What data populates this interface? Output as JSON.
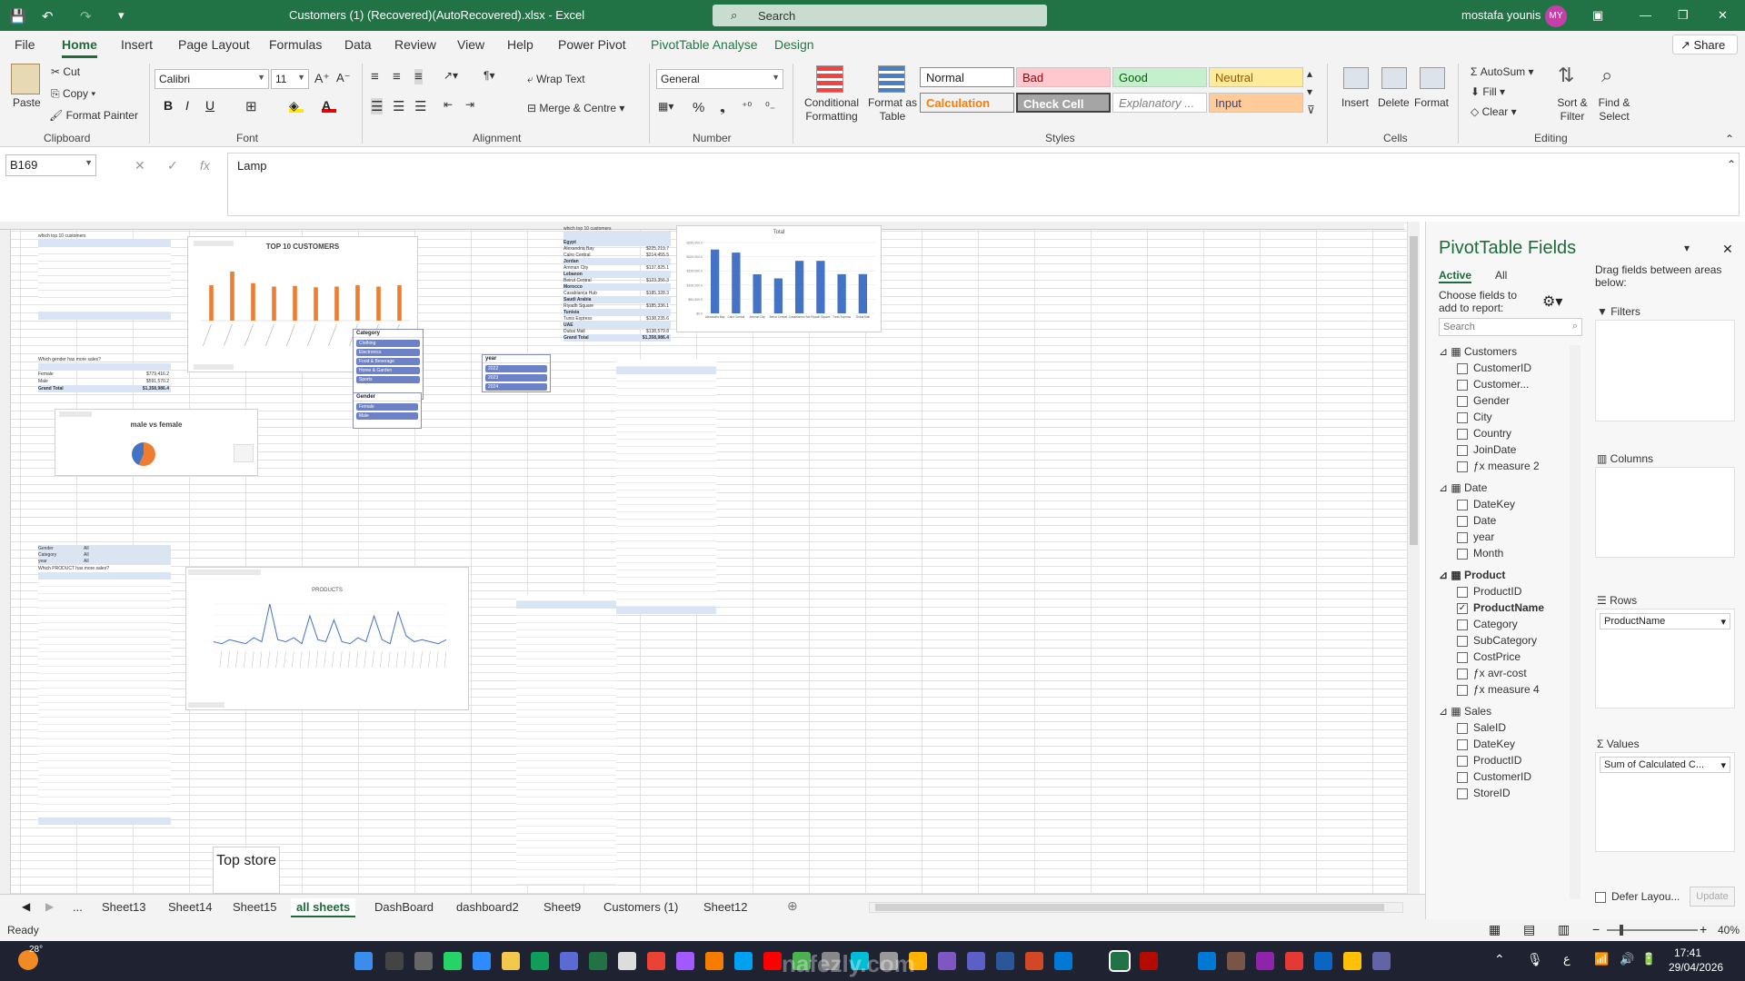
{
  "window": {
    "title": "Customers (1) (Recovered)(AutoRecovered).xlsx - Excel",
    "search": "Search",
    "user": "mostafa younis",
    "initials": "MY"
  },
  "ribbon_tabs": [
    "File",
    "Home",
    "Insert",
    "Page Layout",
    "Formulas",
    "Data",
    "Review",
    "View",
    "Help",
    "Power Pivot",
    "PivotTable Analyse",
    "Design"
  ],
  "share": "Share",
  "clipboard": {
    "paste": "Paste",
    "cut": "Cut",
    "copy": "Copy",
    "format_painter": "Format Painter",
    "label": "Clipboard"
  },
  "font": {
    "name": "Calibri",
    "size": "11",
    "label": "Font",
    "bold": "B",
    "italic": "I",
    "underline": "U"
  },
  "alignment": {
    "wrap": "Wrap Text",
    "merge": "Merge & Centre",
    "label": "Alignment"
  },
  "number": {
    "format": "General",
    "label": "Number"
  },
  "styles": {
    "cond": "Conditional Formatting",
    "fmt_table": "Format as Table",
    "label": "Styles",
    "normal": "Normal",
    "bad": "Bad",
    "good": "Good",
    "neutral": "Neutral",
    "calculation": "Calculation",
    "check": "Check Cell",
    "explanatory": "Explanatory ...",
    "input": "Input"
  },
  "cells": {
    "insert": "Insert",
    "delete": "Delete",
    "format": "Format",
    "label": "Cells"
  },
  "editing": {
    "autosum": "AutoSum",
    "fill": "Fill",
    "clear": "Clear",
    "sort": "Sort & Filter",
    "find": "Find & Select",
    "label": "Editing"
  },
  "formula_bar": {
    "namebox": "B169",
    "fx": "fx",
    "value": "Lamp"
  },
  "sheet": {
    "top10_table_title": "which top 10 customers",
    "top10_chart_title": "TOP 10 CUSTOMERS",
    "gender_q": "Which gender has more sales?",
    "gender_rows": [
      [
        "Female",
        "$779,416.2"
      ],
      [
        "Male",
        "$591,570.2"
      ],
      [
        "Grand Total",
        "$1,358,986.4"
      ]
    ],
    "male_female_title": "male vs female",
    "country_q": "which top 10 customers",
    "country_rows": [
      [
        "Egypt",
        ""
      ],
      [
        "Alexandria Bay",
        "$225,219.7"
      ],
      [
        "Cairo Central",
        "$214,455.5"
      ],
      [
        "Jordan",
        ""
      ],
      [
        "Amman City",
        "$137,825.1"
      ],
      [
        "Lebanon",
        ""
      ],
      [
        "Beirut Central",
        "$123,356.3"
      ],
      [
        "Morocco",
        ""
      ],
      [
        "Casablanca Hub",
        "$185,328.3"
      ],
      [
        "Saudi Arabia",
        ""
      ],
      [
        "Riyadh Square",
        "$185,336.1"
      ],
      [
        "Tunisia",
        ""
      ],
      [
        "Tunis Express",
        "$138,235.6"
      ],
      [
        "UAE",
        ""
      ],
      [
        "Dubai Mall",
        "$138,579.8"
      ],
      [
        "Grand Total",
        "$1,358,986.4"
      ]
    ],
    "total_chart_title": "Total",
    "products_chart_title": "PRODUCTS",
    "product_q": "Which PRODUCT has more sales?",
    "slicer_category": {
      "title": "Category",
      "items": [
        "Clothing",
        "Electronics",
        "Food & Beverage",
        "Home & Garden",
        "Sports"
      ]
    },
    "slicer_year": {
      "title": "year",
      "items": [
        "2022",
        "2023",
        "2024"
      ]
    },
    "slicer_gender": {
      "title": "Gender",
      "items": [
        "Female",
        "Male"
      ]
    },
    "filters": [
      [
        "Gender",
        "All"
      ],
      [
        "Category",
        "All"
      ],
      [
        "year",
        "All"
      ]
    ],
    "top_store": "Top store"
  },
  "sheet_tabs": [
    "...",
    "Sheet13",
    "Sheet14",
    "Sheet15",
    "all sheets",
    "DashBoard",
    "dashboard2",
    "Sheet9",
    "Customers (1)",
    "Sheet12"
  ],
  "active_sheet": "all sheets",
  "status": {
    "ready": "Ready",
    "zoom": "40%"
  },
  "pivot": {
    "title": "PivotTable Fields",
    "tab_active": "Active",
    "tab_all": "All",
    "choose": "Choose fields to add to report:",
    "search": "Search",
    "drag": "Drag fields between areas below:",
    "tables": [
      {
        "name": "Customers",
        "fields": [
          "CustomerID",
          "Customer...",
          "Gender",
          "City",
          "Country",
          "JoinDate",
          "measure 2"
        ]
      },
      {
        "name": "Date",
        "fields": [
          "DateKey",
          "Date",
          "year",
          "Month"
        ]
      },
      {
        "name": "Product",
        "fields": [
          "ProductID",
          "ProductName",
          "Category",
          "SubCategory",
          "CostPrice",
          "avr-cost",
          "measure 4"
        ]
      },
      {
        "name": "Sales",
        "fields": [
          "SaleID",
          "DateKey",
          "ProductID",
          "CustomerID",
          "StoreID"
        ]
      }
    ],
    "filters": "Filters",
    "columns": "Columns",
    "rows": "Rows",
    "rows_value": "ProductName",
    "values": "Values",
    "values_value": "Sum of Calculated C...",
    "defer": "Defer Layou...",
    "update": "Update"
  },
  "taskbar": {
    "temp": "28°",
    "time": "17:41",
    "date": "29/04/2026"
  },
  "watermark": "nafezly.com",
  "chart_data": [
    {
      "type": "bar",
      "title": "Total",
      "categories": [
        "Alexandria Bay",
        "Cairo Central",
        "Amman City",
        "Beirut Central",
        "Casablanca Hub",
        "Riyadh Square",
        "Tunis Express",
        "Dubai Mall"
      ],
      "values": [
        225219.7,
        214455.5,
        137825.1,
        123356.3,
        185328.3,
        185336.1,
        138235.6,
        138579.8
      ],
      "ylim": [
        0,
        250000
      ]
    },
    {
      "type": "bar",
      "title": "TOP 10 CUSTOMERS",
      "values": [
        52,
        72,
        55,
        50,
        51,
        49,
        50,
        52,
        50,
        52
      ]
    },
    {
      "type": "line",
      "title": "PRODUCTS",
      "values": [
        3,
        2,
        4,
        3,
        2,
        5,
        3,
        22,
        4,
        3,
        5,
        2,
        16,
        4,
        3,
        14,
        3,
        2,
        5,
        3,
        16,
        4,
        2,
        18,
        6,
        3,
        4,
        3,
        2,
        4
      ]
    }
  ]
}
